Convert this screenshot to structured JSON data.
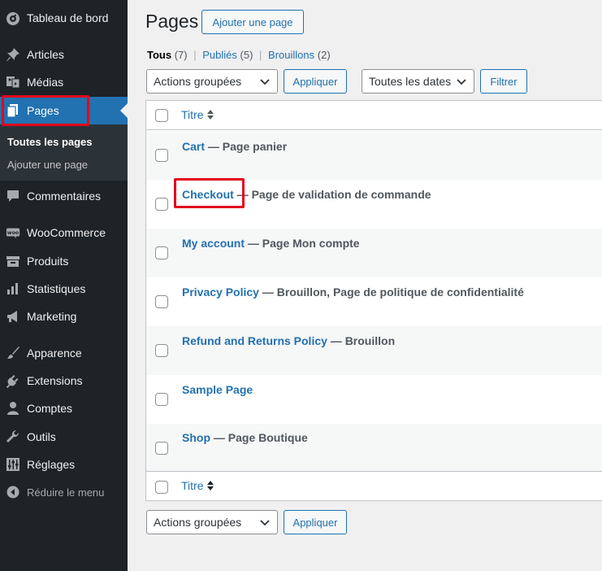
{
  "sidebar": {
    "items": [
      {
        "label": "Tableau de bord",
        "icon": "dashboard-icon"
      },
      {
        "label": "Articles",
        "icon": "pushpin-icon"
      },
      {
        "label": "Médias",
        "icon": "media-icon"
      },
      {
        "label": "Pages",
        "icon": "pages-icon"
      },
      {
        "label": "Commentaires",
        "icon": "comment-icon"
      },
      {
        "label": "WooCommerce",
        "icon": "woocommerce-icon"
      },
      {
        "label": "Produits",
        "icon": "archive-icon"
      },
      {
        "label": "Statistiques",
        "icon": "bar-chart-icon"
      },
      {
        "label": "Marketing",
        "icon": "megaphone-icon"
      },
      {
        "label": "Apparence",
        "icon": "paintbrush-icon"
      },
      {
        "label": "Extensions",
        "icon": "plug-icon"
      },
      {
        "label": "Comptes",
        "icon": "user-icon"
      },
      {
        "label": "Outils",
        "icon": "wrench-icon"
      },
      {
        "label": "Réglages",
        "icon": "sliders-icon"
      },
      {
        "label": "Réduire le menu",
        "icon": "collapse-icon"
      }
    ],
    "submenu": [
      "Toutes les pages",
      "Ajouter une page"
    ]
  },
  "header": {
    "title": "Pages",
    "add_button": "Ajouter une page"
  },
  "filters": {
    "all_label": "Tous",
    "all_count": "(7)",
    "published_label": "Publiés",
    "published_count": "(5)",
    "drafts_label": "Brouillons",
    "drafts_count": "(2)",
    "separator": "|"
  },
  "toolbar": {
    "bulk_select": "Actions groupées",
    "apply": "Appliquer",
    "dates_select": "Toutes les dates",
    "filter": "Filtrer"
  },
  "table": {
    "column_title": "Titre",
    "rows": [
      {
        "title": "Cart",
        "state": " — Page panier"
      },
      {
        "title": "Checkout",
        "state": " — Page de validation de commande"
      },
      {
        "title": "My account",
        "state": " — Page Mon compte"
      },
      {
        "title": "Privacy Policy",
        "state": " — Brouillon, Page de politique de confidentialité"
      },
      {
        "title": "Refund and Returns Policy",
        "state": " — Brouillon"
      },
      {
        "title": "Sample Page",
        "state": ""
      },
      {
        "title": "Shop",
        "state": " — Page Boutique"
      }
    ]
  },
  "colors": {
    "sidebar_bg": "#1d2327",
    "accent": "#2271b1",
    "highlight": "#e2061b"
  }
}
